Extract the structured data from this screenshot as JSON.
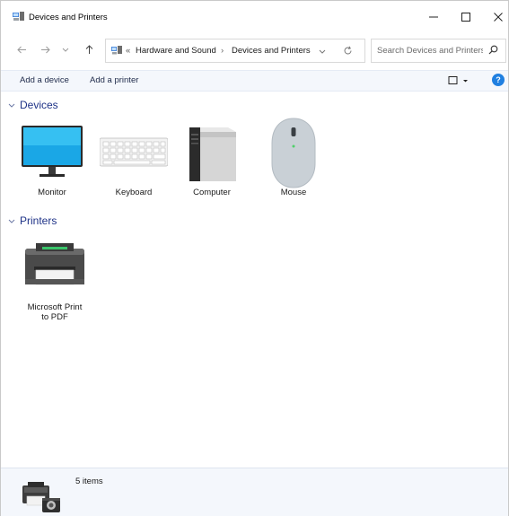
{
  "window": {
    "title": "Devices and Printers"
  },
  "nav": {
    "breadcrumb": {
      "overflow": "«",
      "segment1": "Hardware and Sound",
      "separator": "›",
      "segment2": "Devices and Printers"
    },
    "search_placeholder": "Search Devices and Printers"
  },
  "commands": {
    "add_device": "Add a device",
    "add_printer": "Add a printer"
  },
  "groups": {
    "devices": {
      "label": "Devices",
      "items": [
        "Monitor",
        "Keyboard",
        "Computer",
        "Mouse"
      ]
    },
    "printers": {
      "label": "Printers",
      "items": [
        "Microsoft Print\nto PDF"
      ]
    }
  },
  "status": {
    "count": "5 items"
  },
  "colors": {
    "accent": "#1e3287",
    "help": "#1f7fe0",
    "cmdbar": "#f4f7fc"
  }
}
